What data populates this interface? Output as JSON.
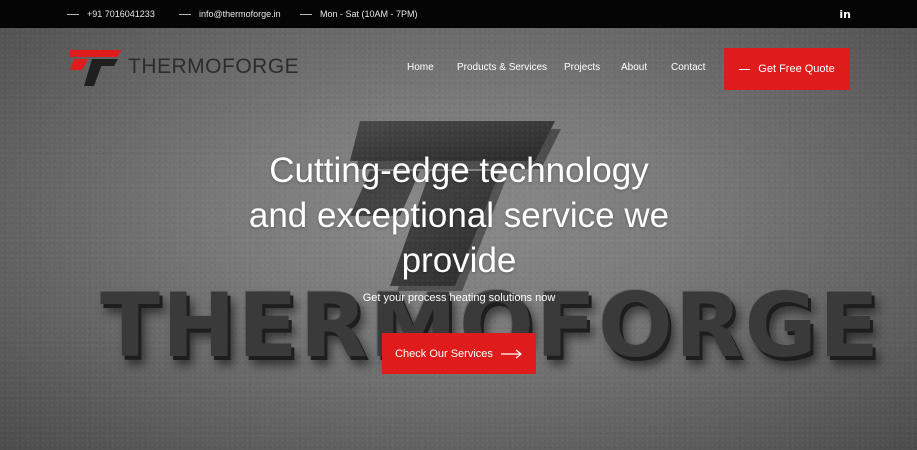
{
  "topbar": {
    "phone": "+91 7016041233",
    "email": "info@thermoforge.in",
    "hours": "Mon - Sat (10AM - 7PM)",
    "social_icon": "linkedin-icon",
    "social_label": "in"
  },
  "brand": {
    "name": "THERMOFORGE",
    "logo_icon": "thermoforge-logo",
    "accent": "#e01b1b"
  },
  "nav": {
    "items": [
      {
        "label": "Home"
      },
      {
        "label": "Products & Services"
      },
      {
        "label": "Projects"
      },
      {
        "label": "About"
      },
      {
        "label": "Contact"
      }
    ],
    "quote_label": "Get Free Quote"
  },
  "hero": {
    "headline_lines": [
      "Cutting-edge technology",
      "and exceptional service we",
      "provide"
    ],
    "subline": "Get your process heating solutions now",
    "cta_label": "Check Our Services",
    "cta_icon": "arrow-right-icon",
    "wall_text": "THERMOFORGE"
  },
  "colors": {
    "accent": "#e01b1b",
    "topbar": "#050505",
    "hero_wall": "#7a7a7a"
  }
}
